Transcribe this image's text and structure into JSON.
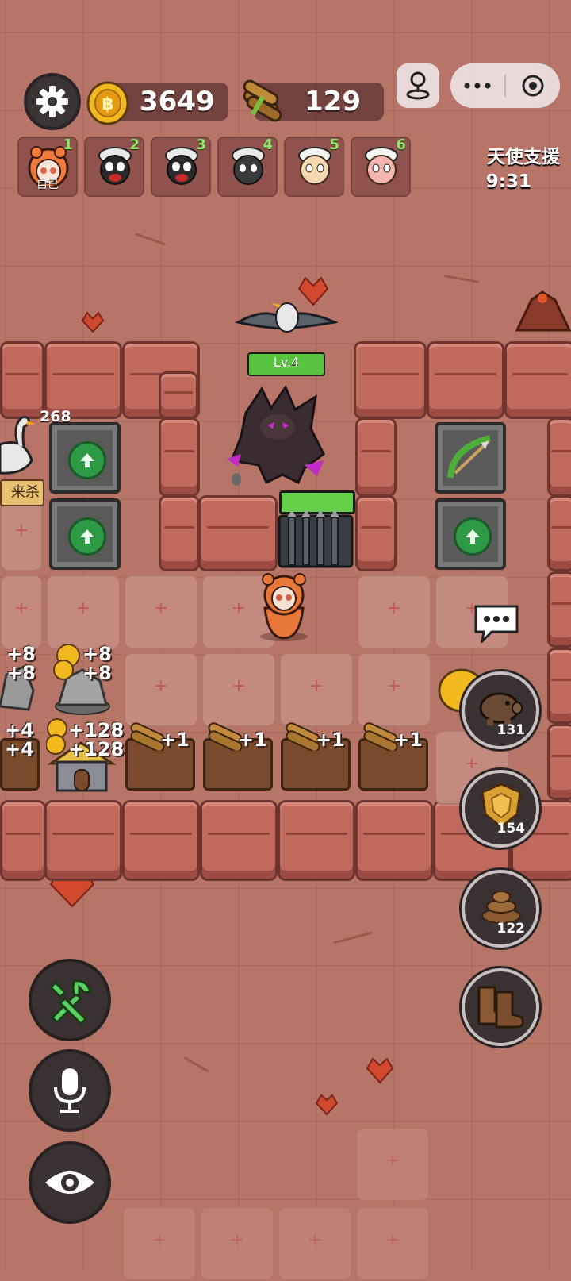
{
  "top_bar": {
    "gold": "3649",
    "wood": "129"
  },
  "players": [
    {
      "num": "1",
      "label": "自己",
      "kind": "self"
    },
    {
      "num": "2",
      "kind": "black-sheep"
    },
    {
      "num": "3",
      "kind": "black-sheep"
    },
    {
      "num": "4",
      "kind": "grey-sheep"
    },
    {
      "num": "5",
      "kind": "white-sheep"
    },
    {
      "num": "6",
      "kind": "pink-sheep"
    }
  ],
  "support": {
    "title": "天使支援",
    "timer": "9:31"
  },
  "enemy": {
    "level_label": "Lv.4",
    "hp_fraction": 1.0
  },
  "gate": {
    "hp_fraction": 1.0
  },
  "goose": {
    "value": "268",
    "tag": "来杀"
  },
  "mines": [
    {
      "line1": "+8",
      "line2": "+8"
    },
    {
      "line1": "+8",
      "line2": "+8"
    }
  ],
  "row_income": {
    "house_left": {
      "line1": "+4",
      "line2": "+4"
    },
    "house_gold": {
      "line1": "+128",
      "line2": "+128"
    },
    "benches": [
      "+1",
      "+1",
      "+1",
      "+1"
    ]
  },
  "side_buttons": {
    "piggy": "131",
    "shield": "154",
    "poop": "122"
  },
  "colors": {
    "floor": "#b77568",
    "wall": "#c06a5e",
    "accent_green": "#58c440"
  },
  "icons": [
    "gear-icon",
    "coin-icon",
    "wood-icon",
    "joystick-icon",
    "more-icon",
    "record-icon",
    "chat-icon",
    "piggy-bank-icon",
    "shield-icon",
    "poop-icon",
    "boots-icon",
    "tools-icon",
    "microphone-icon",
    "eye-icon"
  ]
}
